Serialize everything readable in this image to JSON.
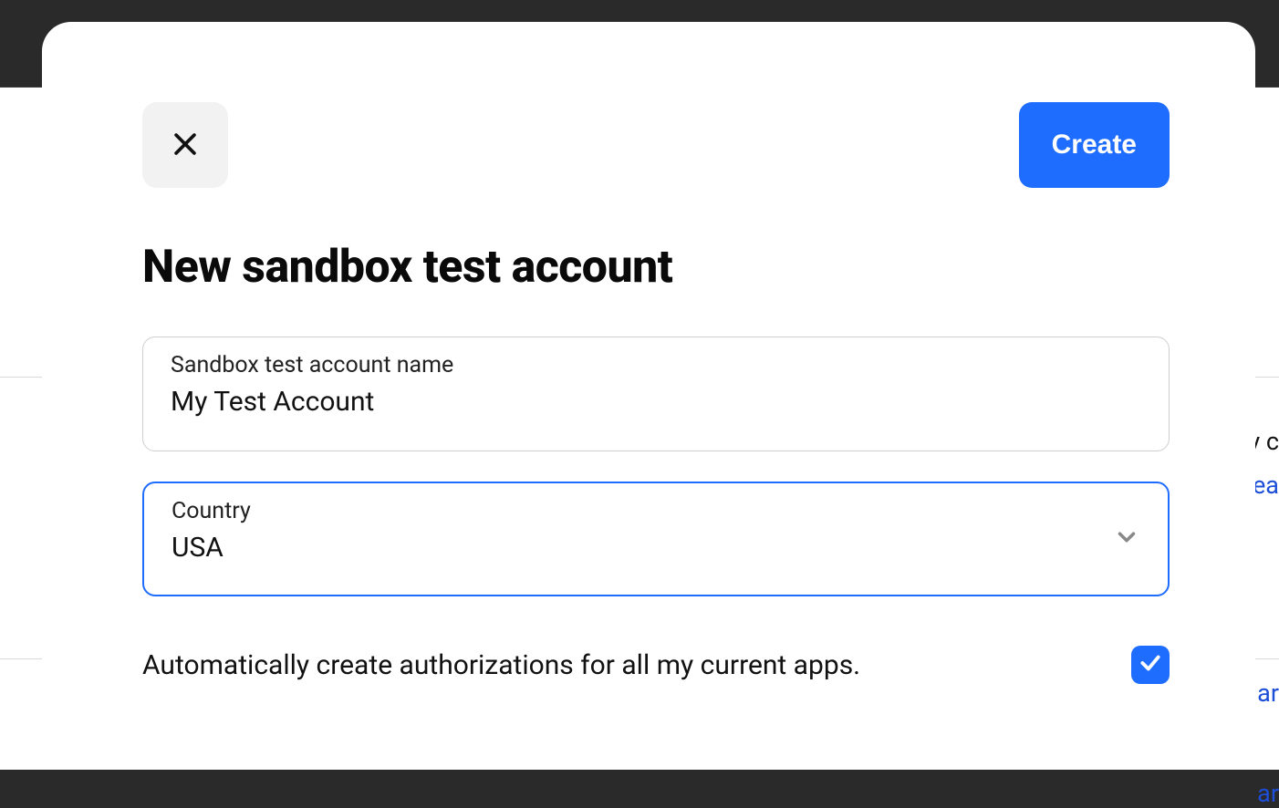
{
  "modal": {
    "title": "New sandbox test account",
    "create_label": "Create",
    "fields": {
      "account_name": {
        "label": "Sandbox test account name",
        "value": "My Test Account"
      },
      "country": {
        "label": "Country",
        "value": "USA"
      }
    },
    "auto_authorize": {
      "label": "Automatically create authorizations for all my current apps.",
      "checked": true
    }
  },
  "backdrop": {
    "text_fragment": "y c",
    "link_fragment_1": "Lea",
    "link_fragment_2": "ar",
    "link_fragment_3": "ar"
  }
}
